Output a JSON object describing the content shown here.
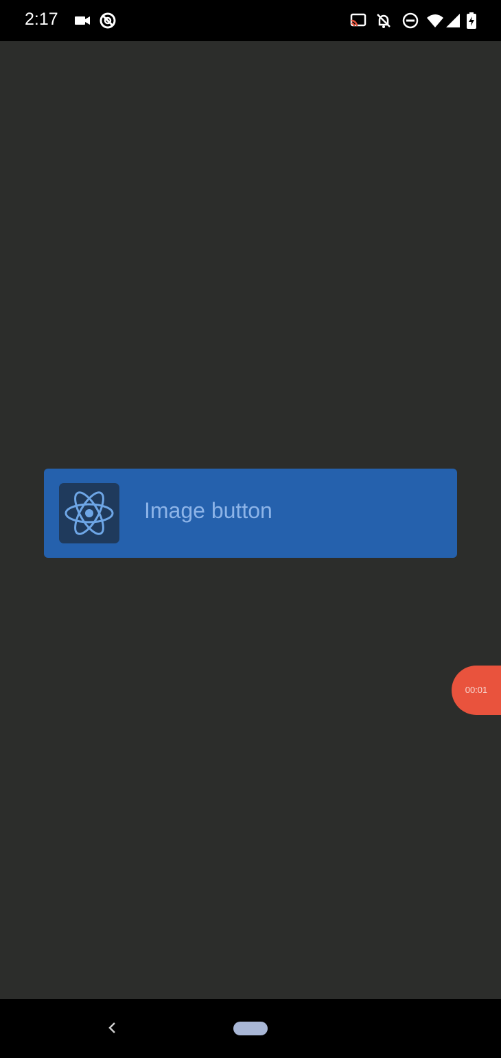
{
  "status_bar": {
    "time": "2:17",
    "icons": [
      "video-camera-icon",
      "sync-icon",
      "cast-icon",
      "notifications-off-icon",
      "do-not-disturb-icon",
      "wifi-icon",
      "signal-icon",
      "battery-charging-icon"
    ]
  },
  "main": {
    "image_button": {
      "label": "Image button",
      "icon": "react-atom-icon",
      "background": "#2561ad"
    }
  },
  "recording_overlay": {
    "timer": "00:01",
    "color": "#e9533d"
  },
  "nav_bar": {
    "icons": [
      "back-icon",
      "home-pill-icon"
    ]
  }
}
